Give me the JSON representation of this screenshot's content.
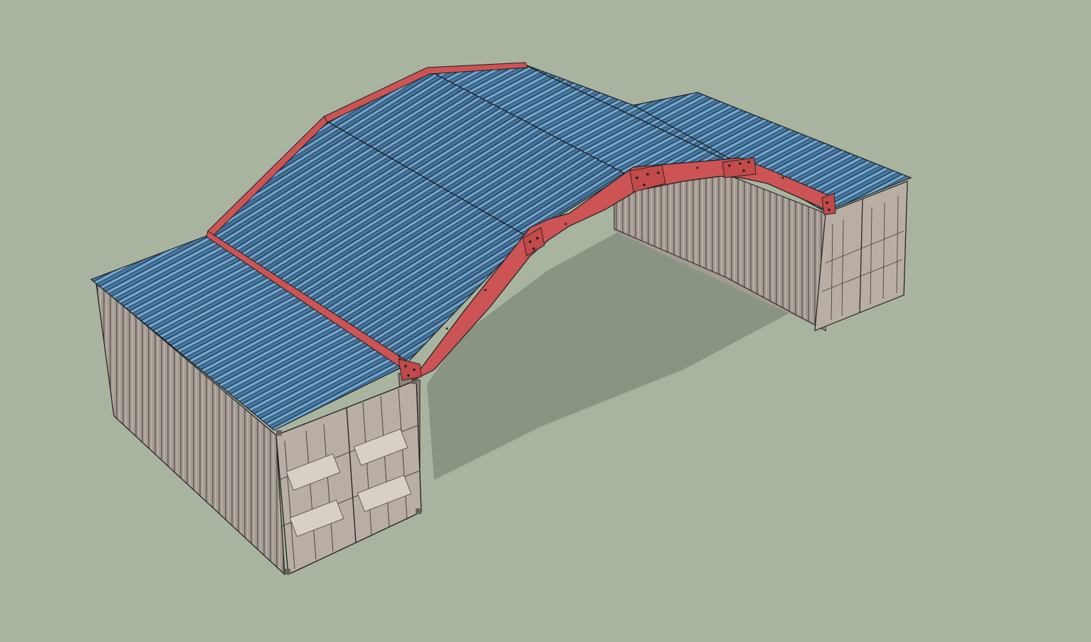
{
  "colors": {
    "background": "#a9b4a0",
    "shadow": "#8a9482",
    "container_side": "#a39a92",
    "container_door": "#b9aea4",
    "container_end_dark": "#8f877f",
    "roof_sheet": "#4d7fa8",
    "roof_sheet_highlight": "#8fc0e4",
    "roof_sheet_dark": "#2e4f6c",
    "truss": "#cc5454",
    "truss_dark": "#9c3a3a",
    "outline": "#1e1e1e"
  },
  "icons": {
    "model": "shipping-container-shelter-model"
  }
}
